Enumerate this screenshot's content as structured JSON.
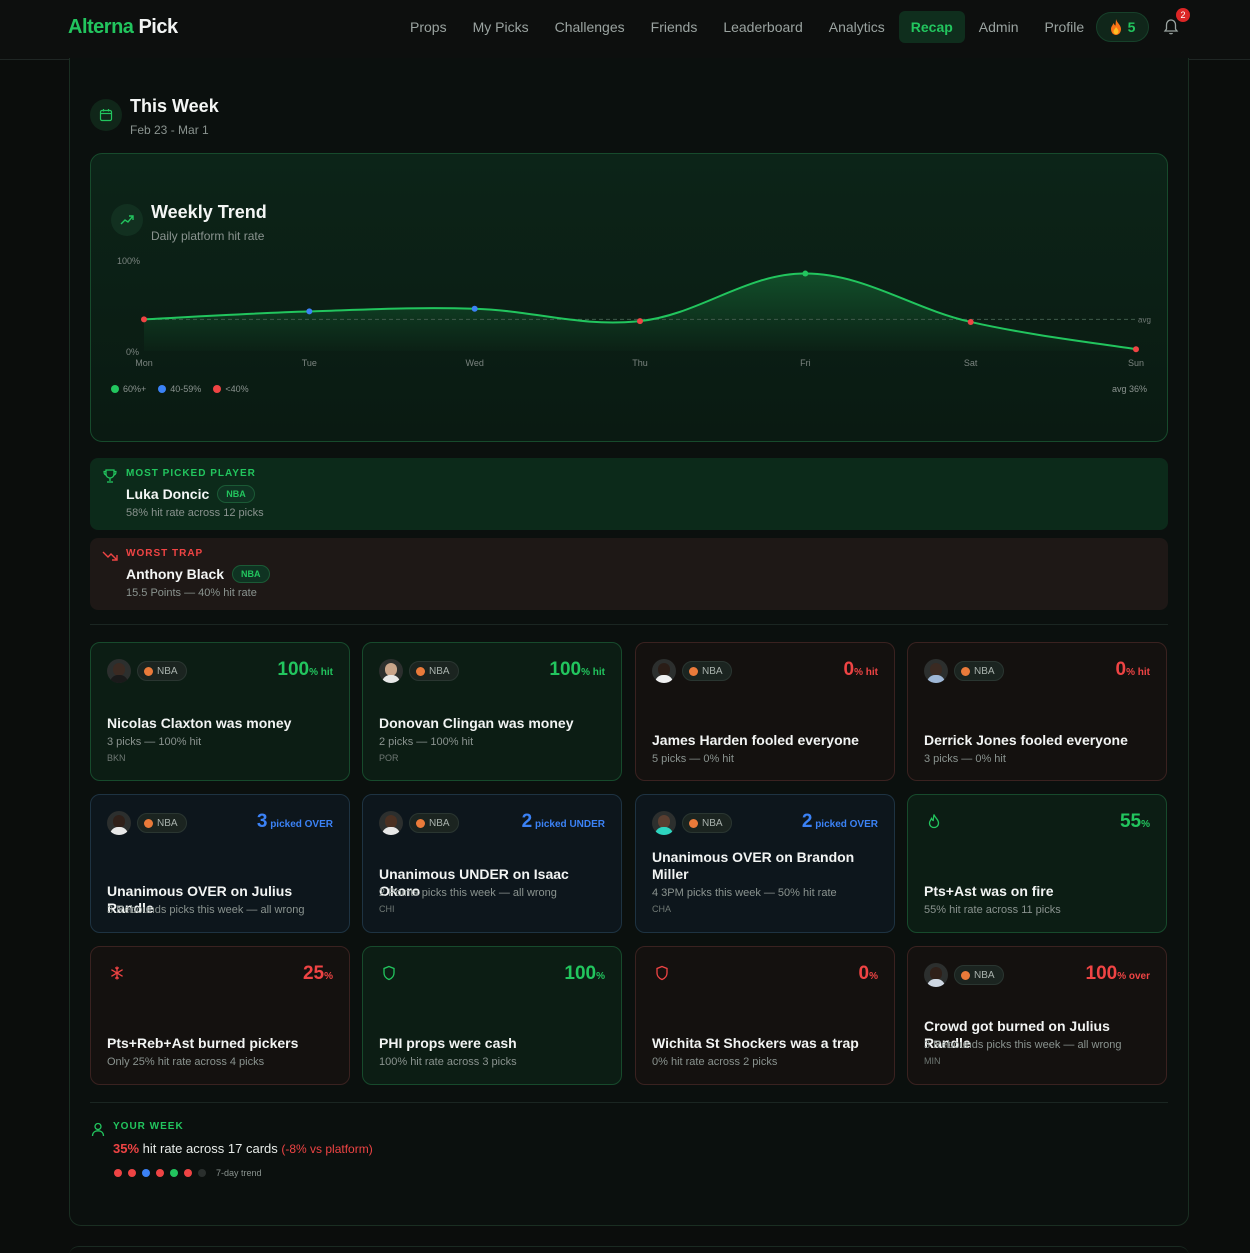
{
  "nav": {
    "brand_a": "Alterna",
    "brand_b": "Pick",
    "items": [
      "Props",
      "My Picks",
      "Challenges",
      "Friends",
      "Leaderboard",
      "Analytics",
      "Recap",
      "Admin",
      "Profile"
    ],
    "active": "Recap",
    "streak": "5",
    "notifications": "2"
  },
  "week": {
    "title": "This Week",
    "dates": "Feb 23 - Mar 1"
  },
  "trend": {
    "title": "Weekly Trend",
    "subtitle": "Daily platform hit rate",
    "legend": [
      "60%+",
      "40-59%",
      "<40%"
    ],
    "avg_label": "avg 36%",
    "avg_tag": "avg"
  },
  "chart_data": {
    "type": "line",
    "x": [
      "Mon",
      "Tue",
      "Wed",
      "Thu",
      "Fri",
      "Sat",
      "Sun"
    ],
    "series": [
      {
        "values": [
          36,
          45,
          48,
          34,
          88,
          33,
          2
        ]
      }
    ],
    "ylim": [
      0,
      100
    ],
    "ytick_labels": [
      "0%",
      "100%"
    ],
    "average": 36,
    "point_colors": [
      "#ef4444",
      "#3b82f6",
      "#3b82f6",
      "#ef4444",
      "#22c55e",
      "#ef4444",
      "#ef4444"
    ],
    "line_color": "#22c55e"
  },
  "most_picked": {
    "label": "MOST PICKED PLAYER",
    "name": "Luka Doncic",
    "league": "NBA",
    "sub": "58% hit rate across 12 picks"
  },
  "worst_trap": {
    "label": "WORST TRAP",
    "name": "Anthony Black",
    "league": "NBA",
    "sub": "15.5 Points — 40% hit rate"
  },
  "cards": [
    {
      "title": "Nicolas Claxton was money",
      "big": "100",
      "small": "% hit",
      "d1": "3 picks — 100% hit",
      "d2": "BKN",
      "league": "NBA"
    },
    {
      "title": "Donovan Clingan was money",
      "big": "100",
      "small": "% hit",
      "d1": "2 picks — 100% hit",
      "d2": "POR",
      "league": "NBA"
    },
    {
      "title": "James Harden fooled everyone",
      "big": "0",
      "small": "% hit",
      "d1": "5 picks — 0% hit",
      "league": "NBA"
    },
    {
      "title": "Derrick Jones fooled everyone",
      "big": "0",
      "small": "% hit",
      "d1": "3 picks — 0% hit",
      "league": "NBA"
    },
    {
      "title": "Unanimous OVER on Julius Randle",
      "big": "3",
      "small": " picked OVER",
      "d1": "3 Rebounds picks this week — all wrong",
      "league": "NBA"
    },
    {
      "title": "Unanimous UNDER on Isaac Okoro",
      "big": "2",
      "small": " picked UNDER",
      "d1": "2 Points picks this week — all wrong",
      "d2": "CHI",
      "league": "NBA"
    },
    {
      "title": "Unanimous OVER on Brandon Miller",
      "big": "2",
      "small": " picked OVER",
      "d1": "4 3PM picks this week — 50% hit rate",
      "d2": "CHA",
      "league": "NBA"
    },
    {
      "title": "Pts+Ast was on fire",
      "big": "55",
      "small": "%",
      "d1": "55% hit rate across 11 picks",
      "icon": "flame-icon"
    },
    {
      "title": "Pts+Reb+Ast burned pickers",
      "big": "25",
      "small": "%",
      "d1": "Only 25% hit rate across 4 picks",
      "icon": "snowflake-icon"
    },
    {
      "title": "PHI props were cash",
      "big": "100",
      "small": "%",
      "d1": "100% hit rate across 3 picks",
      "icon": "shield-icon"
    },
    {
      "title": "Wichita St Shockers was a trap",
      "big": "0",
      "small": "%",
      "d1": "0% hit rate across 2 picks",
      "icon": "shield-icon"
    },
    {
      "title": "Crowd got burned on Julius Randle",
      "big": "100",
      "small": "% over",
      "d1": "3 Rebounds picks this week — all wrong",
      "d2": "MIN",
      "league": "NBA"
    }
  ],
  "your_week": {
    "label": "YOUR WEEK",
    "pct": "35%",
    "text": " hit rate across 17 cards ",
    "diff": "(-8% vs platform)",
    "trend_label": "7-day trend",
    "dot_colors": [
      "#ef4444",
      "#ef4444",
      "#3b82f6",
      "#ef4444",
      "#22c55e",
      "#ef4444",
      "#2a2f2d"
    ]
  }
}
